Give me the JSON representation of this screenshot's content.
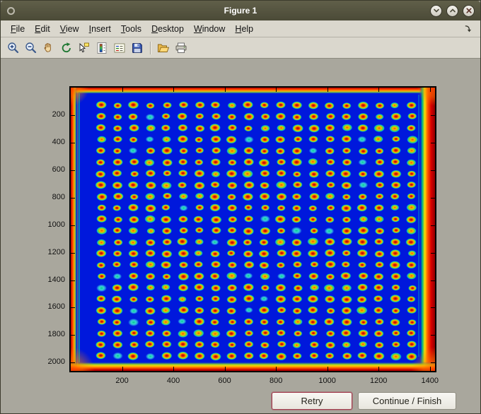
{
  "window": {
    "title": "Figure 1",
    "controls": [
      "window-menu",
      "minimize",
      "maximize",
      "close"
    ]
  },
  "menubar": {
    "items": [
      "File",
      "Edit",
      "View",
      "Insert",
      "Tools",
      "Desktop",
      "Window",
      "Help"
    ],
    "dock_icon": "dock-arrow"
  },
  "toolbar": {
    "icons": [
      "zoom-in",
      "zoom-out",
      "pan-hand",
      "rotate-3d",
      "data-cursor",
      "insert-colorbar",
      "insert-legend",
      "save-figure",
      "open-file",
      "print-figure"
    ]
  },
  "figure": {
    "axes": {
      "x_ticks": [
        200,
        400,
        600,
        800,
        1000,
        1200,
        1400
      ],
      "y_ticks": [
        200,
        400,
        600,
        800,
        1000,
        1200,
        1400,
        1600,
        1800,
        2000
      ],
      "x_max": 1420,
      "y_max": 2060
    },
    "image": {
      "description": "pseudocolor microarray scan, jet colormap",
      "background": "#0018dc",
      "grid": {
        "rows": 23,
        "cols": 20
      },
      "spot_palette": {
        "center": "#a80000",
        "mid": "#ff9e00",
        "halo": "#00c8c0"
      },
      "edge_palette": [
        "#b40000",
        "#ff5a00",
        "#ffd200",
        "#30c878"
      ]
    }
  },
  "buttons": {
    "retry": "Retry",
    "continue_finish": "Continue / Finish"
  },
  "colors": {
    "titlebar": "#55543f",
    "chrome": "#dad7cd",
    "figure_bg": "#a9a79d",
    "retry_border": "#a23c4e"
  }
}
